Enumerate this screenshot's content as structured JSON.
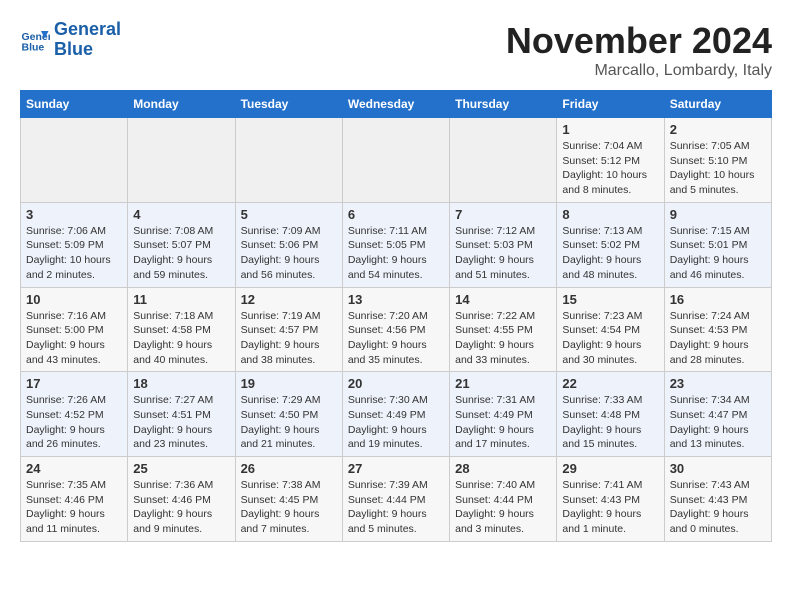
{
  "header": {
    "logo_line1": "General",
    "logo_line2": "Blue",
    "month": "November 2024",
    "location": "Marcallo, Lombardy, Italy"
  },
  "weekdays": [
    "Sunday",
    "Monday",
    "Tuesday",
    "Wednesday",
    "Thursday",
    "Friday",
    "Saturday"
  ],
  "weeks": [
    [
      {
        "day": "",
        "info": ""
      },
      {
        "day": "",
        "info": ""
      },
      {
        "day": "",
        "info": ""
      },
      {
        "day": "",
        "info": ""
      },
      {
        "day": "",
        "info": ""
      },
      {
        "day": "1",
        "info": "Sunrise: 7:04 AM\nSunset: 5:12 PM\nDaylight: 10 hours and 8 minutes."
      },
      {
        "day": "2",
        "info": "Sunrise: 7:05 AM\nSunset: 5:10 PM\nDaylight: 10 hours and 5 minutes."
      }
    ],
    [
      {
        "day": "3",
        "info": "Sunrise: 7:06 AM\nSunset: 5:09 PM\nDaylight: 10 hours and 2 minutes."
      },
      {
        "day": "4",
        "info": "Sunrise: 7:08 AM\nSunset: 5:07 PM\nDaylight: 9 hours and 59 minutes."
      },
      {
        "day": "5",
        "info": "Sunrise: 7:09 AM\nSunset: 5:06 PM\nDaylight: 9 hours and 56 minutes."
      },
      {
        "day": "6",
        "info": "Sunrise: 7:11 AM\nSunset: 5:05 PM\nDaylight: 9 hours and 54 minutes."
      },
      {
        "day": "7",
        "info": "Sunrise: 7:12 AM\nSunset: 5:03 PM\nDaylight: 9 hours and 51 minutes."
      },
      {
        "day": "8",
        "info": "Sunrise: 7:13 AM\nSunset: 5:02 PM\nDaylight: 9 hours and 48 minutes."
      },
      {
        "day": "9",
        "info": "Sunrise: 7:15 AM\nSunset: 5:01 PM\nDaylight: 9 hours and 46 minutes."
      }
    ],
    [
      {
        "day": "10",
        "info": "Sunrise: 7:16 AM\nSunset: 5:00 PM\nDaylight: 9 hours and 43 minutes."
      },
      {
        "day": "11",
        "info": "Sunrise: 7:18 AM\nSunset: 4:58 PM\nDaylight: 9 hours and 40 minutes."
      },
      {
        "day": "12",
        "info": "Sunrise: 7:19 AM\nSunset: 4:57 PM\nDaylight: 9 hours and 38 minutes."
      },
      {
        "day": "13",
        "info": "Sunrise: 7:20 AM\nSunset: 4:56 PM\nDaylight: 9 hours and 35 minutes."
      },
      {
        "day": "14",
        "info": "Sunrise: 7:22 AM\nSunset: 4:55 PM\nDaylight: 9 hours and 33 minutes."
      },
      {
        "day": "15",
        "info": "Sunrise: 7:23 AM\nSunset: 4:54 PM\nDaylight: 9 hours and 30 minutes."
      },
      {
        "day": "16",
        "info": "Sunrise: 7:24 AM\nSunset: 4:53 PM\nDaylight: 9 hours and 28 minutes."
      }
    ],
    [
      {
        "day": "17",
        "info": "Sunrise: 7:26 AM\nSunset: 4:52 PM\nDaylight: 9 hours and 26 minutes."
      },
      {
        "day": "18",
        "info": "Sunrise: 7:27 AM\nSunset: 4:51 PM\nDaylight: 9 hours and 23 minutes."
      },
      {
        "day": "19",
        "info": "Sunrise: 7:29 AM\nSunset: 4:50 PM\nDaylight: 9 hours and 21 minutes."
      },
      {
        "day": "20",
        "info": "Sunrise: 7:30 AM\nSunset: 4:49 PM\nDaylight: 9 hours and 19 minutes."
      },
      {
        "day": "21",
        "info": "Sunrise: 7:31 AM\nSunset: 4:49 PM\nDaylight: 9 hours and 17 minutes."
      },
      {
        "day": "22",
        "info": "Sunrise: 7:33 AM\nSunset: 4:48 PM\nDaylight: 9 hours and 15 minutes."
      },
      {
        "day": "23",
        "info": "Sunrise: 7:34 AM\nSunset: 4:47 PM\nDaylight: 9 hours and 13 minutes."
      }
    ],
    [
      {
        "day": "24",
        "info": "Sunrise: 7:35 AM\nSunset: 4:46 PM\nDaylight: 9 hours and 11 minutes."
      },
      {
        "day": "25",
        "info": "Sunrise: 7:36 AM\nSunset: 4:46 PM\nDaylight: 9 hours and 9 minutes."
      },
      {
        "day": "26",
        "info": "Sunrise: 7:38 AM\nSunset: 4:45 PM\nDaylight: 9 hours and 7 minutes."
      },
      {
        "day": "27",
        "info": "Sunrise: 7:39 AM\nSunset: 4:44 PM\nDaylight: 9 hours and 5 minutes."
      },
      {
        "day": "28",
        "info": "Sunrise: 7:40 AM\nSunset: 4:44 PM\nDaylight: 9 hours and 3 minutes."
      },
      {
        "day": "29",
        "info": "Sunrise: 7:41 AM\nSunset: 4:43 PM\nDaylight: 9 hours and 1 minute."
      },
      {
        "day": "30",
        "info": "Sunrise: 7:43 AM\nSunset: 4:43 PM\nDaylight: 9 hours and 0 minutes."
      }
    ]
  ]
}
